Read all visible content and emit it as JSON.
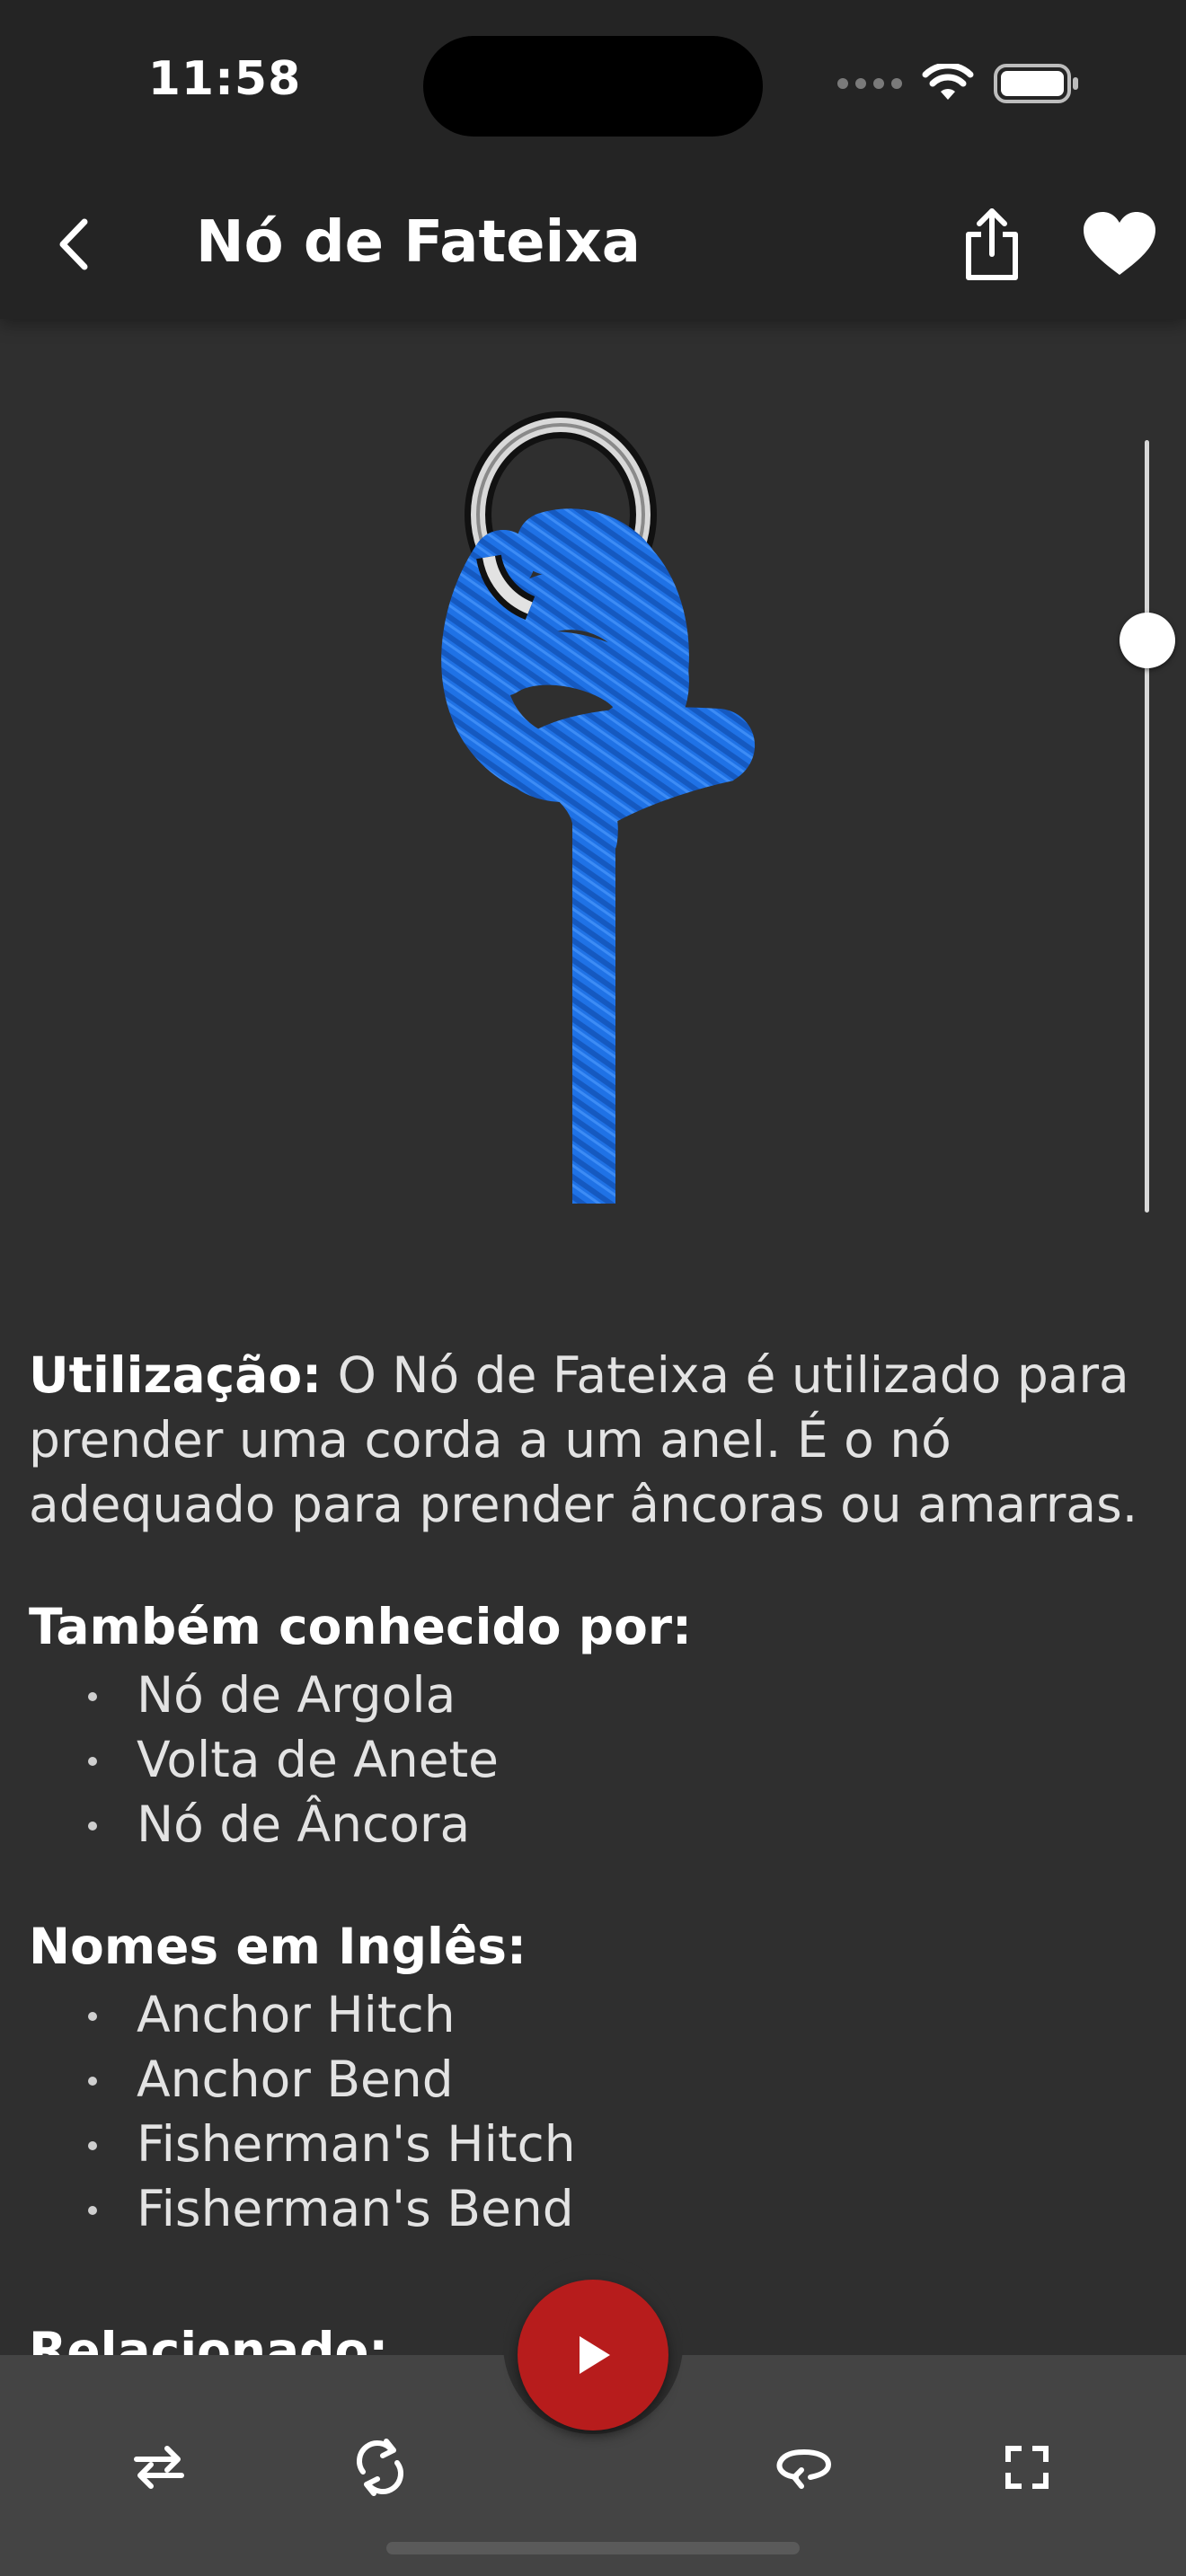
{
  "status_bar": {
    "time": "11:58"
  },
  "header": {
    "title": "Nó de Fateixa",
    "icons": [
      "chevron-left-icon",
      "share-icon",
      "heart-icon"
    ]
  },
  "viewer": {
    "rope_color": "#1e6fe0",
    "ring_color": "#c9c9c9",
    "step_slider_position": 0.74
  },
  "usage": {
    "label": "Utilização:",
    "text": " O Nó de Fateixa é utilizado para prender uma corda a um anel. É o nó adequado para prender âncoras ou amarras."
  },
  "also_known": {
    "title": "Também conhecido por:",
    "items": [
      "Nó de Argola",
      "Volta de Anete",
      "Nó de Âncora"
    ]
  },
  "english_names": {
    "title": "Nomes em Inglês:",
    "items": [
      "Anchor Hitch",
      "Anchor Bend",
      "Fisherman's Hitch",
      "Fisherman's Bend"
    ]
  },
  "related": {
    "title": "Relacionado:"
  },
  "toolbar": {
    "icons": [
      "swap-icon",
      "rotate-icon",
      "play-icon",
      "loop-icon",
      "fullscreen-icon"
    ],
    "accent": "#b71c1c"
  }
}
